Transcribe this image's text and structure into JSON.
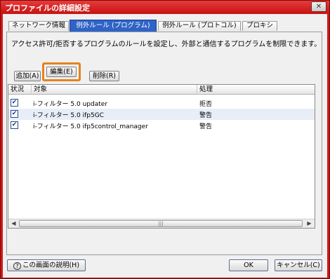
{
  "window": {
    "title": "プロファイルの詳細設定",
    "close_icon": "close-icon"
  },
  "tabs": [
    {
      "label": "ネットワーク情報",
      "active": false
    },
    {
      "label": "例外ルール (プログラム)",
      "active": true
    },
    {
      "label": "例外ルール (プロトコル)",
      "active": false
    },
    {
      "label": "プロキシ",
      "active": false
    }
  ],
  "panel": {
    "description": "アクセス許可/拒否するプログラムのルールを設定し、外部と通信するプログラムを制限できます。",
    "buttons": {
      "add": "追加(A)",
      "edit": "編集(E)",
      "delete": "削除(R)"
    },
    "highlight_color": "#e5821e"
  },
  "table": {
    "columns": [
      "状況",
      "対象",
      "処理"
    ],
    "rows": [
      {
        "checked": true,
        "target": "i-フィルター 5.0 updater",
        "action": "拒否"
      },
      {
        "checked": true,
        "target": "i-フィルター 5.0 ifp5GC",
        "action": "警告"
      },
      {
        "checked": true,
        "target": "i-フィルター 5.0 ifp5control_manager",
        "action": "警告"
      }
    ]
  },
  "footer": {
    "help": "この画面の説明(H)",
    "ok": "OK",
    "cancel": "キャンセル(C)"
  },
  "colors": {
    "window_frame": "#d01818",
    "active_tab": "#2f63c7"
  }
}
